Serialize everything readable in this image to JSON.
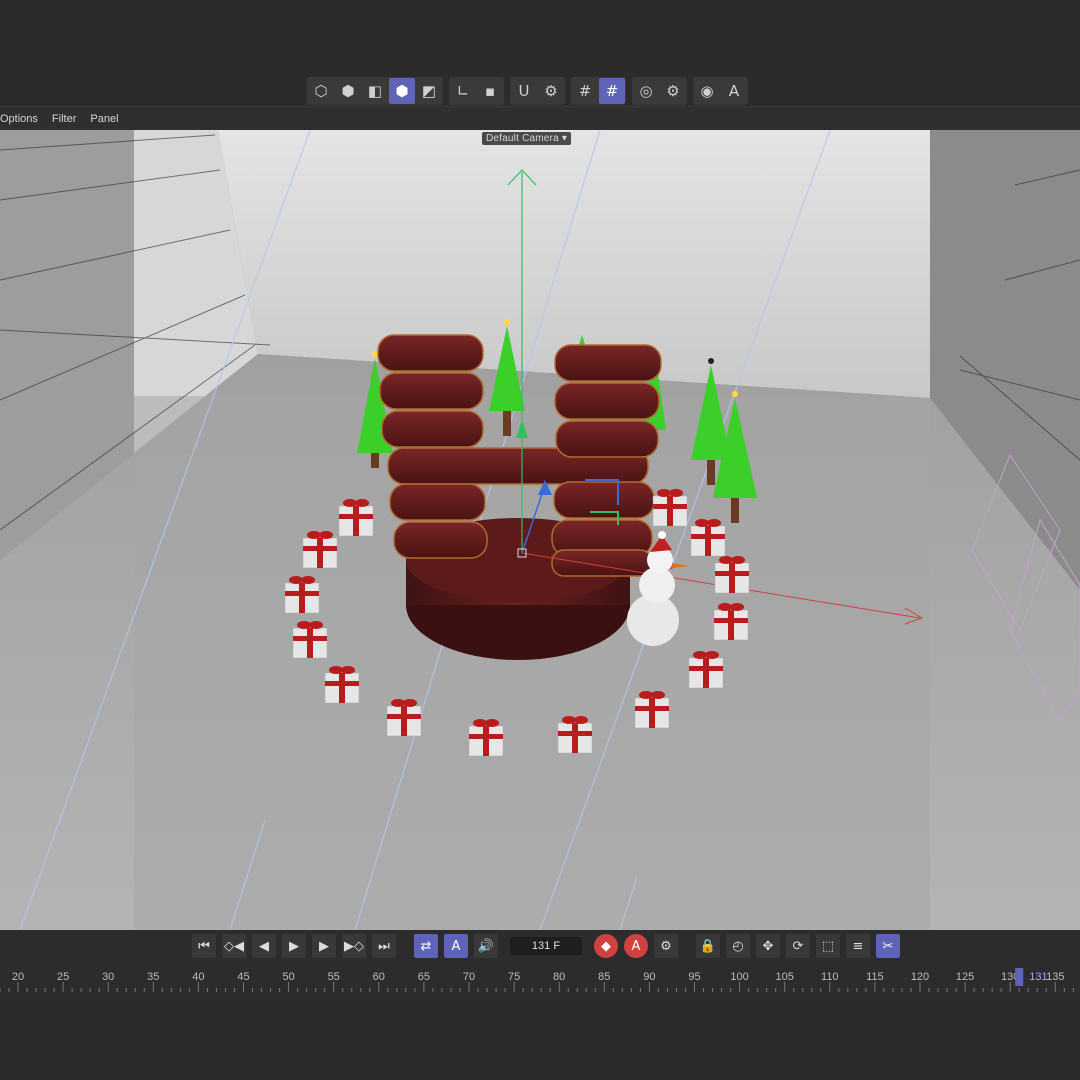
{
  "menu": {
    "items": [
      "Options",
      "Filter",
      "Panel"
    ]
  },
  "viewport": {
    "camera_label": "Default Camera"
  },
  "toolbar": {
    "groups": [
      [
        {
          "icon": "points-mode-icon",
          "glyph": "⬡"
        },
        {
          "icon": "edges-mode-icon",
          "glyph": "⬢"
        },
        {
          "icon": "polygons-mode-icon",
          "glyph": "◧"
        },
        {
          "icon": "model-mode-icon",
          "glyph": "⬢",
          "active": true
        },
        {
          "icon": "uvw-mode-icon",
          "glyph": "◩"
        }
      ],
      [
        {
          "icon": "axis-icon",
          "glyph": "∟"
        },
        {
          "icon": "solo-icon",
          "glyph": "▪"
        }
      ],
      [
        {
          "icon": "magnet-snap-icon",
          "glyph": "Ս"
        },
        {
          "icon": "snap-settings-icon",
          "glyph": "⚙"
        }
      ],
      [
        {
          "icon": "grid-icon",
          "glyph": "#"
        },
        {
          "icon": "workplane-icon",
          "glyph": "#",
          "active": true
        }
      ],
      [
        {
          "icon": "render-view-icon",
          "glyph": "◎"
        },
        {
          "icon": "render-settings-icon",
          "glyph": "⚙"
        }
      ],
      [
        {
          "icon": "visibility-icon",
          "glyph": "◉"
        },
        {
          "icon": "text-icon",
          "glyph": "A"
        }
      ]
    ]
  },
  "timeline": {
    "frame": "131 F",
    "current_frame": 131,
    "ticks": [
      20,
      25,
      30,
      35,
      40,
      45,
      50,
      55,
      60,
      65,
      70,
      75,
      80,
      85,
      90,
      95,
      100,
      105,
      110,
      115,
      120,
      125,
      130,
      135
    ],
    "transport": [
      {
        "icon": "go-to-start-icon",
        "glyph": "⏮"
      },
      {
        "icon": "previous-key-icon",
        "glyph": "◇◀"
      },
      {
        "icon": "previous-frame-icon",
        "glyph": "◀"
      },
      {
        "icon": "play-icon",
        "glyph": "▶"
      },
      {
        "icon": "next-frame-icon",
        "glyph": "▶"
      },
      {
        "icon": "next-key-icon",
        "glyph": "▶◇"
      },
      {
        "icon": "go-to-end-icon",
        "glyph": "⏭"
      }
    ],
    "modes": [
      {
        "icon": "loop-icon",
        "glyph": "⇄",
        "active": true
      },
      {
        "icon": "auto-key-mode-icon",
        "glyph": "A",
        "active": true
      },
      {
        "icon": "sound-icon",
        "glyph": "🔊"
      }
    ],
    "keys": [
      {
        "icon": "record-key-icon",
        "glyph": "◆",
        "color": "#d24040"
      },
      {
        "icon": "autokey-icon",
        "glyph": "A",
        "color": "#d24040"
      },
      {
        "icon": "key-settings-icon",
        "glyph": "⚙",
        "color": ""
      }
    ],
    "tracks": [
      {
        "icon": "lock-icon",
        "glyph": "🔒"
      },
      {
        "icon": "motion-icon",
        "glyph": "◴"
      },
      {
        "icon": "move-key-icon",
        "glyph": "✥"
      },
      {
        "icon": "rotate-key-icon",
        "glyph": "⟳"
      },
      {
        "icon": "scale-key-icon",
        "glyph": "⬚"
      },
      {
        "icon": "parameter-key-icon",
        "glyph": "≡"
      },
      {
        "icon": "pla-key-icon",
        "glyph": "✂",
        "active": true
      }
    ]
  },
  "colors": {
    "accent": "#5f64b8",
    "ribbon": "#b81c1c",
    "tree": "#3ccf2a",
    "wood": "#5a1c1c"
  }
}
